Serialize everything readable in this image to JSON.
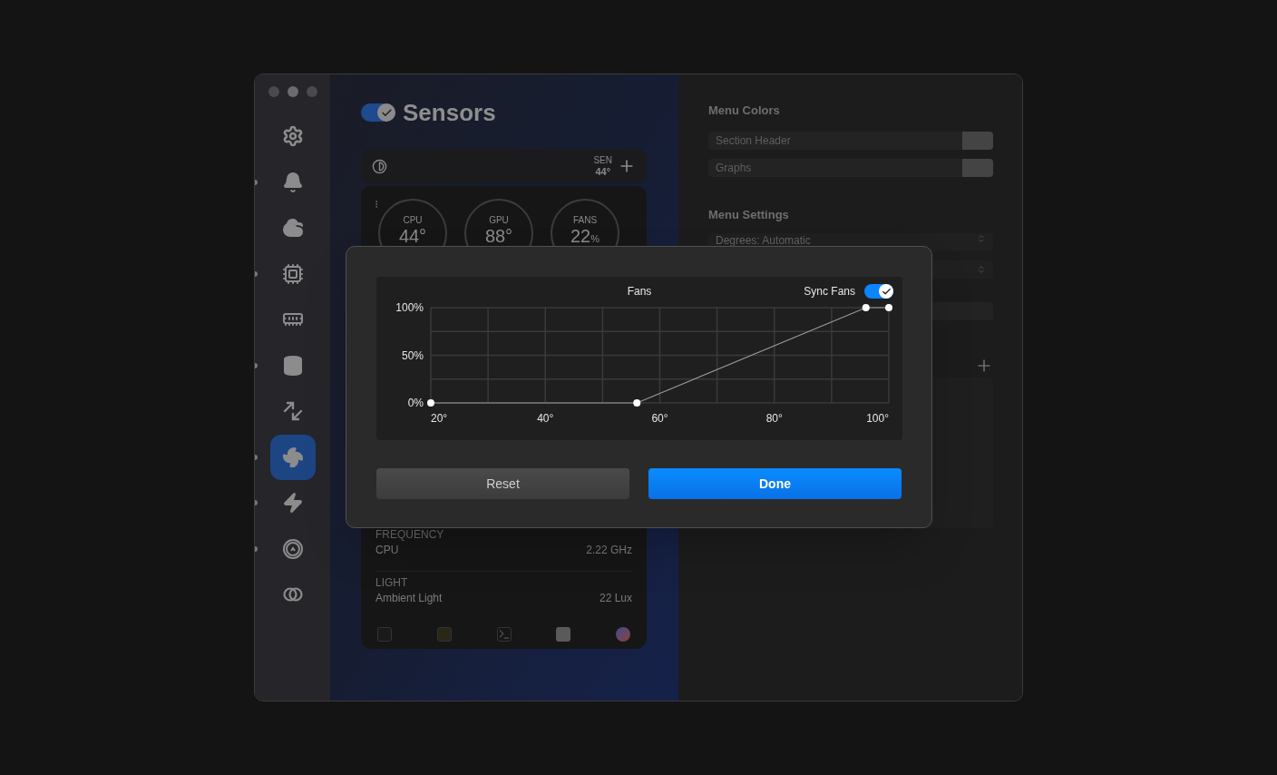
{
  "window": {
    "controls": [
      {
        "kind": "close"
      },
      {
        "kind": "minimize"
      },
      {
        "kind": "zoom"
      }
    ]
  },
  "sidebar": {
    "items": [
      {
        "selected": false,
        "enabled": false
      },
      {
        "selected": false,
        "enabled": true
      },
      {
        "selected": false,
        "enabled": false
      },
      {
        "selected": false,
        "enabled": true
      },
      {
        "selected": false,
        "enabled": false
      },
      {
        "selected": false,
        "enabled": true
      },
      {
        "selected": false,
        "enabled": false
      },
      {
        "selected": true,
        "enabled": true
      },
      {
        "selected": false,
        "enabled": true
      },
      {
        "selected": false,
        "enabled": true
      },
      {
        "selected": false,
        "enabled": false
      }
    ]
  },
  "header": {
    "on": true,
    "title": "Sensors"
  },
  "summary_card": {
    "label": "SEN",
    "value": "44°"
  },
  "gauges": [
    {
      "label": "CPU",
      "value": "44°"
    },
    {
      "label": "GPU",
      "value": "88°"
    },
    {
      "label": "FANS",
      "value": "22",
      "unit": "%"
    }
  ],
  "readings": [
    {
      "category": "FREQUENCY",
      "name": "CPU",
      "value": "2.22 GHz"
    },
    {
      "category": "LIGHT",
      "name": "Ambient Light",
      "value": "22 Lux"
    }
  ],
  "menu_colors": {
    "heading": "Menu Colors",
    "items": [
      {
        "label": "Section Header"
      },
      {
        "label": "Graphs"
      }
    ]
  },
  "menu_settings": {
    "heading": "Menu Settings",
    "dropdowns": [
      "Degrees: Automatic"
    ]
  },
  "dialog": {
    "sync_label": "Sync Fans",
    "sync_on": true,
    "chart_data": {
      "type": "line",
      "grid": true,
      "x": [
        20,
        56,
        96,
        100
      ],
      "series": [
        {
          "name": "Fans",
          "color": "#9a9a9a",
          "marker": true,
          "values": [
            0,
            0,
            100,
            100
          ]
        }
      ],
      "xlim": [
        20,
        100
      ],
      "ylim": [
        0,
        100
      ],
      "xticks": [
        {
          "value": 20,
          "label": "20°"
        },
        {
          "value": 40,
          "label": "40°"
        },
        {
          "value": 60,
          "label": "60°"
        },
        {
          "value": 80,
          "label": "80°"
        },
        {
          "value": 100,
          "label": "100°"
        }
      ],
      "yticks": [
        {
          "value": 0,
          "label": "0%"
        },
        {
          "value": 50,
          "label": "50%"
        },
        {
          "value": 100,
          "label": "100%"
        }
      ]
    },
    "buttons": [
      {
        "label": "Reset",
        "kind": "secondary"
      },
      {
        "label": "Done",
        "kind": "primary"
      }
    ]
  }
}
